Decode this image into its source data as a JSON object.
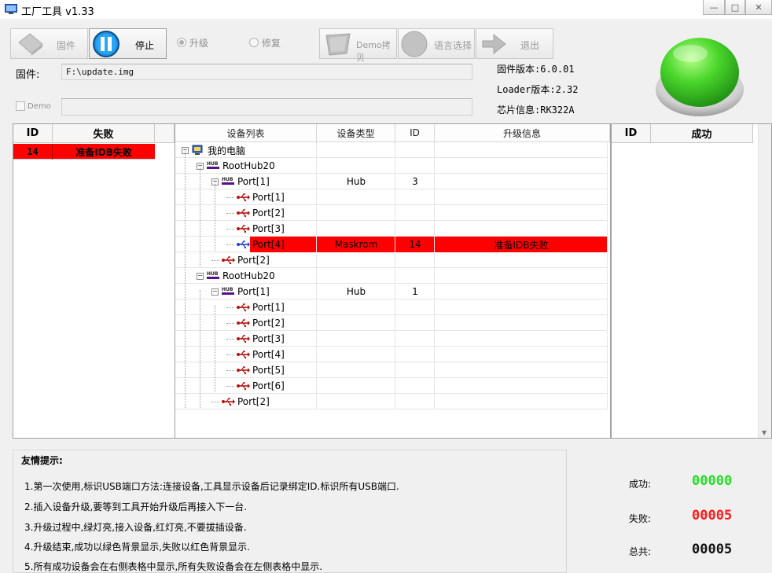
{
  "window": {
    "title": "工厂工具 v1.33",
    "controls": {
      "minimize": "—",
      "maximize": "□",
      "close": "✕"
    }
  },
  "toolbar": {
    "firmware_button": "固件",
    "stop_button": "停止",
    "upgrade_radio": "升级",
    "repair_radio": "修复",
    "demo_copy_button": "Demo拷贝",
    "language_button": "语言选择",
    "exit_button": "退出"
  },
  "firmware": {
    "label": "固件:",
    "path": "F:\\update.img",
    "demo_label": "Demo",
    "demo_path": ""
  },
  "info": {
    "firmware_version": "固件版本:6.0.01",
    "loader_version": "Loader版本:2.32",
    "chip_info": "芯片信息:RK322A"
  },
  "fail_table": {
    "headers": {
      "id": "ID",
      "status": "失败"
    },
    "rows": [
      {
        "id": "14",
        "status": "准备IDB失败"
      }
    ]
  },
  "device_table": {
    "headers": {
      "list": "设备列表",
      "type": "设备类型",
      "id": "ID",
      "info": "升级信息"
    },
    "root": "我的电脑",
    "rows": [
      {
        "label": "我的电脑",
        "type": "",
        "id": "",
        "info": ""
      },
      {
        "label": "RootHub20",
        "type": "",
        "id": "",
        "info": ""
      },
      {
        "label": "Port[1]",
        "type": "Hub",
        "id": "3",
        "info": ""
      },
      {
        "label": "Port[1]",
        "type": "",
        "id": "",
        "info": ""
      },
      {
        "label": "Port[2]",
        "type": "",
        "id": "",
        "info": ""
      },
      {
        "label": "Port[3]",
        "type": "",
        "id": "",
        "info": ""
      },
      {
        "label": "Port[4]",
        "type": "Maskrom",
        "id": "14",
        "info": "准备IDB失败"
      },
      {
        "label": "Port[2]",
        "type": "",
        "id": "",
        "info": ""
      },
      {
        "label": "RootHub20",
        "type": "",
        "id": "",
        "info": ""
      },
      {
        "label": "Port[1]",
        "type": "Hub",
        "id": "1",
        "info": ""
      },
      {
        "label": "Port[1]",
        "type": "",
        "id": "",
        "info": ""
      },
      {
        "label": "Port[2]",
        "type": "",
        "id": "",
        "info": ""
      },
      {
        "label": "Port[3]",
        "type": "",
        "id": "",
        "info": ""
      },
      {
        "label": "Port[4]",
        "type": "",
        "id": "",
        "info": ""
      },
      {
        "label": "Port[5]",
        "type": "",
        "id": "",
        "info": ""
      },
      {
        "label": "Port[6]",
        "type": "",
        "id": "",
        "info": ""
      },
      {
        "label": "Port[2]",
        "type": "",
        "id": "",
        "info": ""
      }
    ]
  },
  "success_table": {
    "headers": {
      "id": "ID",
      "status": "成功"
    },
    "rows": []
  },
  "tips": {
    "title": "友情提示:",
    "items": [
      "1.第一次使用,标识USB端口方法:连接设备,工具显示设备后记录绑定ID.标识所有USB端口.",
      "2.插入设备升级,要等到工具开始升级后再接入下一台.",
      "3.升级过程中,绿灯亮,接入设备,红灯亮,不要拔插设备.",
      "4.升级结束,成功以绿色背景显示,失败以红色背景显示.",
      "5.所有成功设备会在右侧表格中显示,所有失败设备会在左侧表格中显示."
    ]
  },
  "stats": {
    "success_label": "成功:",
    "success_value": "00000",
    "fail_label": "失败:",
    "fail_value": "00005",
    "total_label": "总共:",
    "total_value": "00005"
  },
  "colors": {
    "success": "#22e022",
    "fail": "#ff1a1a",
    "total": "#111111",
    "fail_row": "#ff0000",
    "status_light": "#3cd13c"
  },
  "icons": {
    "firmware": "chip-icon",
    "stop": "pause-icon",
    "demo_copy": "copy-icon",
    "language": "globe-icon",
    "exit": "exit-arrow-icon",
    "usb": "usb-icon",
    "hub": "hub-icon",
    "computer": "computer-icon",
    "status": "status-light-icon"
  }
}
